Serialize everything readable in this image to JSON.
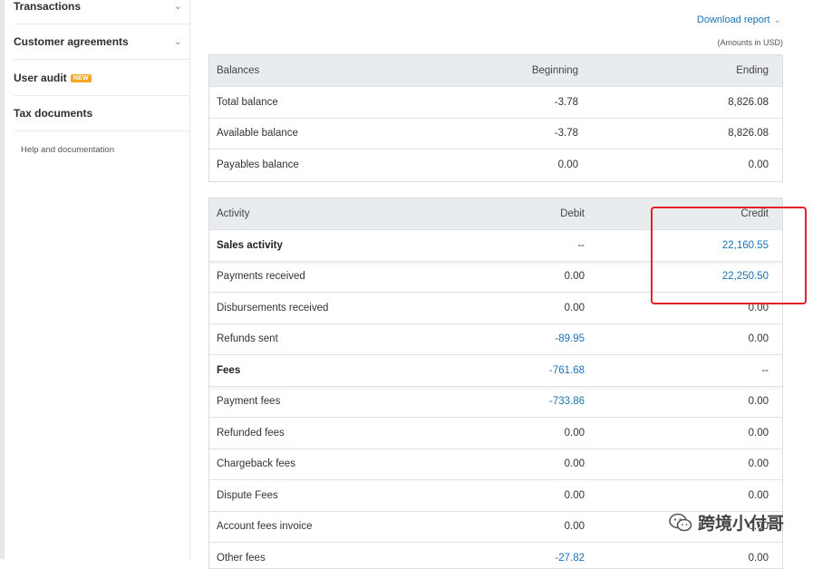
{
  "sidebar": {
    "items": [
      {
        "label": "Transactions",
        "chevron": true
      },
      {
        "label": "Customer agreements",
        "chevron": true
      },
      {
        "label": "User audit",
        "badge": "NEW"
      },
      {
        "label": "Tax documents"
      }
    ],
    "help": "Help and documentation"
  },
  "header": {
    "download": "Download report",
    "amounts_note": "(Amounts in USD)"
  },
  "balances": {
    "headers": [
      "Balances",
      "Beginning",
      "Ending"
    ],
    "rows": [
      {
        "label": "Total balance",
        "beginning": "-3.78",
        "ending": "8,826.08"
      },
      {
        "label": "Available balance",
        "beginning": "-3.78",
        "ending": "8,826.08"
      },
      {
        "label": "Payables balance",
        "beginning": "0.00",
        "ending": "0.00"
      }
    ]
  },
  "activity": {
    "headers": [
      "Activity",
      "Debit",
      "Credit"
    ],
    "rows": [
      {
        "label": "Sales activity",
        "debit": "--",
        "credit": "22,160.55"
      },
      {
        "label": "Payments received",
        "debit": "0.00",
        "credit": "22,250.50"
      },
      {
        "label": "Disbursements received",
        "debit": "0.00",
        "credit": "0.00"
      },
      {
        "label": "Refunds sent",
        "debit": "-89.95",
        "credit": "0.00"
      },
      {
        "label": "Fees",
        "debit": "-761.68",
        "credit": "--"
      },
      {
        "label": "Payment fees",
        "debit": "-733.86",
        "credit": "0.00"
      },
      {
        "label": "Refunded fees",
        "debit": "0.00",
        "credit": "0.00"
      },
      {
        "label": "Chargeback fees",
        "debit": "0.00",
        "credit": "0.00"
      },
      {
        "label": "Dispute Fees",
        "debit": "0.00",
        "credit": "0.00"
      },
      {
        "label": "Account fees invoice",
        "debit": "0.00",
        "credit": "0.00"
      },
      {
        "label": "Other fees",
        "debit": "-27.82",
        "credit": "0.00"
      }
    ]
  },
  "watermark": "跨境小付哥",
  "colors": {
    "link": "#1a73b8",
    "highlight": "#e5202a",
    "badge": "#f5a623"
  }
}
